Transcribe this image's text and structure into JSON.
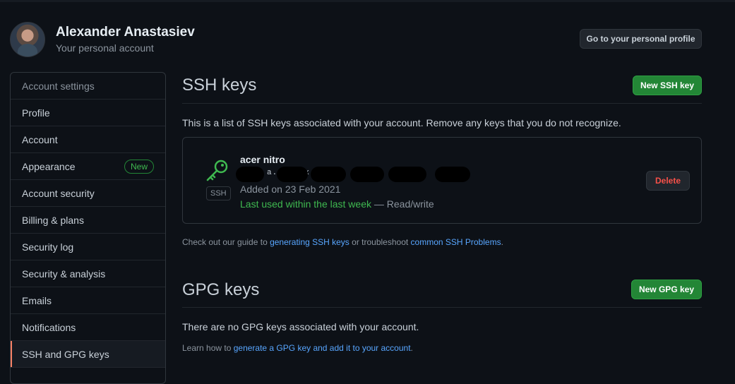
{
  "profile": {
    "name": "Alexander Anastasiev",
    "subtitle": "Your personal account",
    "goto_button": "Go to your personal profile"
  },
  "sidebar": {
    "header": "Account settings",
    "items": [
      {
        "label": "Profile"
      },
      {
        "label": "Account"
      },
      {
        "label": "Appearance",
        "badge": "New"
      },
      {
        "label": "Account security"
      },
      {
        "label": "Billing & plans"
      },
      {
        "label": "Security log"
      },
      {
        "label": "Security & analysis"
      },
      {
        "label": "Emails"
      },
      {
        "label": "Notifications"
      },
      {
        "label": "SSH and GPG keys",
        "selected": true
      }
    ]
  },
  "ssh": {
    "title": "SSH keys",
    "new_button": "New SSH key",
    "description": "This is a list of SSH keys associated with your account. Remove any keys that you do not recognize.",
    "key": {
      "icon": "key-icon",
      "type_label": "SSH",
      "name": "acer nitro",
      "fingerprint_visible": "     S:L.                a.            l.              ex         I",
      "added": "Added on 23 Feb 2021",
      "last_used": "Last used within the last week",
      "access": " — Read/write",
      "delete_button": "Delete"
    },
    "guide": {
      "prefix": "Check out our guide to ",
      "link1": "generating SSH keys",
      "middle": " or troubleshoot ",
      "link2": "common SSH Problems",
      "suffix": "."
    }
  },
  "gpg": {
    "title": "GPG keys",
    "new_button": "New GPG key",
    "description": "There are no GPG keys associated with your account.",
    "learn": {
      "prefix": "Learn how to ",
      "link": "generate a GPG key and add it to your account",
      "suffix": "."
    }
  },
  "colors": {
    "background": "#0d1117",
    "accent_green": "#238636",
    "link_blue": "#58a6ff",
    "danger_red": "#f85149",
    "selected_marker": "#f78166"
  }
}
